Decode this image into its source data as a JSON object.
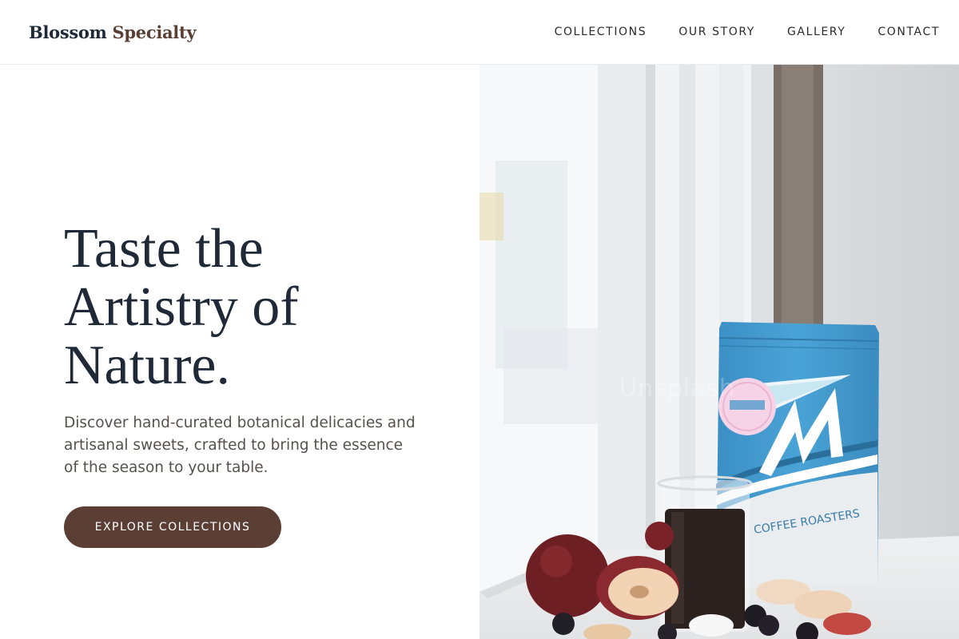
{
  "header": {
    "logo_part1": "Blossom",
    "logo_part2": "Specialty",
    "nav": [
      "COLLECTIONS",
      "OUR STORY",
      "GALLERY",
      "CONTACT"
    ]
  },
  "hero": {
    "title_lines": [
      "Taste the",
      "Artistry of",
      "Nature."
    ],
    "description": "Discover hand-curated botanical delicacies and artisanal sweets, crafted to bring the essence of the season to your table.",
    "cta_label": "EXPLORE COLLECTIONS"
  },
  "photo": {
    "bag_brand": "COFFEE ROASTERS",
    "watermark": "Unsplash"
  },
  "colors": {
    "brand_brown": "#5b3f35",
    "heading": "#1f2937",
    "bag_blue": "#3d94c8"
  }
}
